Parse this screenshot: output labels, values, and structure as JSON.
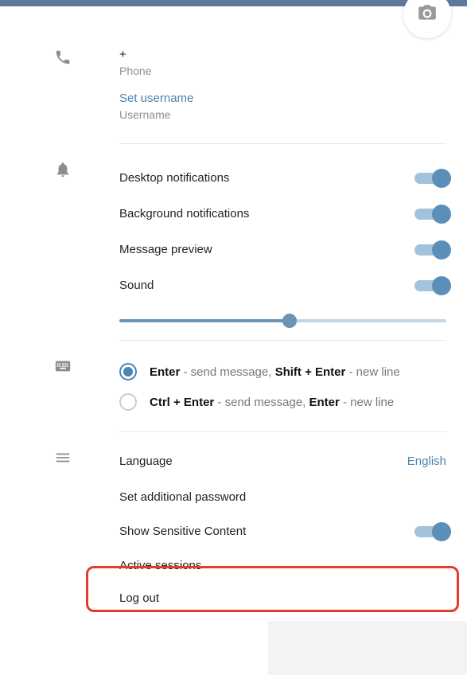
{
  "profile": {
    "phone_value": "+",
    "phone_label": "Phone",
    "set_username": "Set username",
    "username_label": "Username"
  },
  "notifications": {
    "desktop": "Desktop notifications",
    "background": "Background notifications",
    "preview": "Message preview",
    "sound": "Sound",
    "volume_percent": 52
  },
  "send": {
    "opt1_b1": "Enter",
    "opt1_mid": " - send message, ",
    "opt1_b2": "Shift + Enter",
    "opt1_end": " - new line",
    "opt2_b1": "Ctrl + Enter",
    "opt2_mid": " - send message, ",
    "opt2_b2": "Enter",
    "opt2_end": " - new line"
  },
  "general": {
    "language_label": "Language",
    "language_value": "English",
    "set_password": "Set additional password",
    "sensitive": "Show Sensitive Content",
    "active_sessions": "Active sessions",
    "log_out": "Log out"
  }
}
